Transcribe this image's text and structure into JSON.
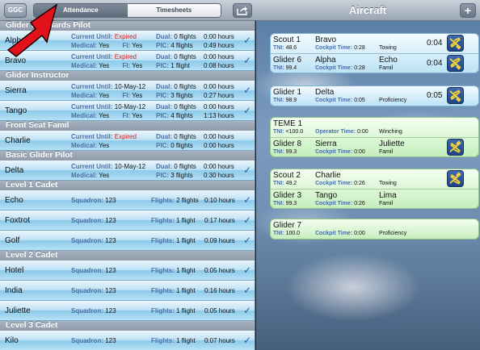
{
  "toolbar": {
    "ggc_label": "GGC",
    "tabs": [
      {
        "label": "Attendance"
      },
      {
        "label": "Timesheets"
      }
    ],
    "title": "Aircraft",
    "add_label": "+"
  },
  "left": {
    "sections": [
      {
        "title": "Glider Standards Pilot"
      },
      {
        "title": "Glider Instructor"
      },
      {
        "title": "Front Seat Famil"
      },
      {
        "title": "Basic Glider Pilot"
      },
      {
        "title": "Level 1 Cadet"
      },
      {
        "title": "Level 2 Cadet"
      },
      {
        "title": "Level 3 Cadet"
      }
    ],
    "labels": {
      "current_until": "Current Until:",
      "medical": "Medical:",
      "fi": "FI:",
      "dual": "Dual:",
      "pic": "PIC:",
      "squadron": "Squadron:",
      "flights": "Flights:"
    },
    "pilots": [
      {
        "name": "Alpha",
        "current_until": "Expired",
        "expired": true,
        "medical": "Yes",
        "fi": "Yes",
        "dual": "0 flights",
        "dual_hours": "0:00 hours",
        "pic": "4 flights",
        "pic_hours": "0:49 hours"
      },
      {
        "name": "Bravo",
        "current_until": "Expired",
        "expired": true,
        "medical": "Yes",
        "fi": "Yes",
        "dual": "0 flights",
        "dual_hours": "0:00 hours",
        "pic": "1 flight",
        "pic_hours": "0:08 hours"
      },
      {
        "name": "Sierra",
        "current_until": "10-May-12",
        "expired": false,
        "medical": "Yes",
        "fi": "Yes",
        "dual": "0 flights",
        "dual_hours": "0:00 hours",
        "pic": "3 flights",
        "pic_hours": "0:27 hours"
      },
      {
        "name": "Tango",
        "current_until": "10-May-12",
        "expired": false,
        "medical": "Yes",
        "fi": "Yes",
        "dual": "0 flights",
        "dual_hours": "0:00 hours",
        "pic": "4 flights",
        "pic_hours": "1:13 hours"
      },
      {
        "name": "Charlie",
        "current_until": "Expired",
        "expired": true,
        "medical": "Yes",
        "dual": "0 flights",
        "dual_hours": "0:00 hours",
        "pic": "0 flights",
        "pic_hours": "0:00 hours"
      },
      {
        "name": "Delta",
        "current_until": "10-May-12",
        "expired": false,
        "medical": "Yes",
        "dual": "0 flights",
        "dual_hours": "0:00 hours",
        "pic": "3 flights",
        "pic_hours": "0:30 hours"
      }
    ],
    "cadets": [
      {
        "name": "Echo",
        "squadron": "123",
        "flights": "2 flights",
        "hours": "0:10 hours"
      },
      {
        "name": "Foxtrot",
        "squadron": "123",
        "flights": "1 flight",
        "hours": "0:17 hours"
      },
      {
        "name": "Golf",
        "squadron": "123",
        "flights": "1 flight",
        "hours": "0:09 hours"
      },
      {
        "name": "Hotel",
        "squadron": "123",
        "flights": "1 flight",
        "hours": "0:05 hours"
      },
      {
        "name": "India",
        "squadron": "123",
        "flights": "1 flight",
        "hours": "0:16 hours"
      },
      {
        "name": "Juliette",
        "squadron": "123",
        "flights": "1 flight",
        "hours": "0:05 hours"
      },
      {
        "name": "Kilo",
        "squadron": "123",
        "flights": "1 flight",
        "hours": "0:07 hours"
      }
    ],
    "check": "✓"
  },
  "right": {
    "labels": {
      "tni": "TNI:",
      "cockpit_time": "Cockpit Time:",
      "operator_time": "Operator Time:"
    },
    "cards": [
      {
        "color": "blue",
        "lines": [
          {
            "glider": "Scout 1",
            "tni": "48.6",
            "p1": "Bravo",
            "time_label": "Cockpit Time:",
            "time_value": "0:28",
            "p2": "",
            "mode": "Towing",
            "elapsed": "0:04",
            "plane": true
          },
          {
            "glider": "Glider 6",
            "tni": "99.4",
            "p1": "Alpha",
            "time_label": "Cockpit Time:",
            "time_value": "0:28",
            "p2": "Echo",
            "mode": "Famil",
            "elapsed": "0:04",
            "plane": true
          }
        ]
      },
      {
        "color": "blue",
        "lines": [
          {
            "glider": "Glider 1",
            "tni": "98.9",
            "p1": "Delta",
            "time_label": "Cockpit Time:",
            "time_value": "0:05",
            "p2": "",
            "mode": "Proficiency",
            "elapsed": "0:05",
            "plane": true
          }
        ]
      },
      {
        "color": "green",
        "lines": [
          {
            "glider": "TEME 1",
            "tni": "<100.0",
            "p1": "",
            "time_label": "Operator Time:",
            "time_value": "0:00",
            "p2": "",
            "mode": "Winching",
            "elapsed": "",
            "plane": false
          },
          {
            "glider": "Glider 8",
            "tni": "99.3",
            "p1": "Sierra",
            "time_label": "Cockpit Time:",
            "time_value": "0:00",
            "p2": "Juliette",
            "mode": "Famil",
            "elapsed": "",
            "plane": true
          }
        ]
      },
      {
        "color": "green",
        "lines": [
          {
            "glider": "Scout 2",
            "tni": "49.2",
            "p1": "Charlie",
            "time_label": "Cockpit Time:",
            "time_value": "0:26",
            "p2": "",
            "mode": "Towing",
            "elapsed": "",
            "plane": true
          },
          {
            "glider": "Glider 3",
            "tni": "99.3",
            "p1": "Tango",
            "time_label": "Cockpit Time:",
            "time_value": "0:26",
            "p2": "Lima",
            "mode": "Famil",
            "elapsed": "",
            "plane": false
          }
        ]
      },
      {
        "color": "green",
        "lines": [
          {
            "glider": "Glider 7",
            "tni": "100.0",
            "p1": "",
            "time_label": "Cockpit Time:",
            "time_value": "0:00",
            "p2": "",
            "mode": "Proficiency",
            "elapsed": "",
            "plane": false
          }
        ]
      }
    ]
  },
  "colors": {
    "expired": "#d21f1f",
    "label_blue": "#4a6fa5",
    "annotation_arrow": "#e3111a"
  }
}
